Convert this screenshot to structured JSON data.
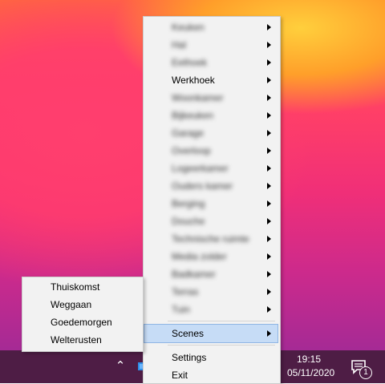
{
  "context_menu": {
    "items": [
      {
        "label": "Keuken",
        "blurred": true
      },
      {
        "label": "Hal",
        "blurred": true
      },
      {
        "label": "Eethoek",
        "blurred": true
      },
      {
        "label": "Werkhoek",
        "blurred": false
      },
      {
        "label": "Woonkamer",
        "blurred": true
      },
      {
        "label": "Bijkeuken",
        "blurred": true
      },
      {
        "label": "Garage",
        "blurred": true
      },
      {
        "label": "Overloop",
        "blurred": true
      },
      {
        "label": "Logeerkamer",
        "blurred": true
      },
      {
        "label": "Ouders kamer",
        "blurred": true
      },
      {
        "label": "Berging",
        "blurred": true
      },
      {
        "label": "Douche",
        "blurred": true
      },
      {
        "label": "Technische ruimte",
        "blurred": true
      },
      {
        "label": "Media zolder",
        "blurred": true
      },
      {
        "label": "Badkamer",
        "blurred": true
      },
      {
        "label": "Terras",
        "blurred": true
      },
      {
        "label": "Tuin",
        "blurred": true
      }
    ],
    "scenes_label": "Scenes",
    "settings_label": "Settings",
    "exit_label": "Exit"
  },
  "scenes_submenu": {
    "items": [
      "Thuiskomst",
      "Weggaan",
      "Goedemorgen",
      "Welterusten"
    ]
  },
  "taskbar": {
    "time": "19:15",
    "date": "05/11/2020",
    "notification_count": "1",
    "chevron_icon": "chevron-up-icon",
    "notification_icon": "action-center-icon"
  },
  "colors": {
    "taskbar": "#4e1d45",
    "menu_bg": "#f2f2f2",
    "highlight": "#c6dcf6"
  }
}
